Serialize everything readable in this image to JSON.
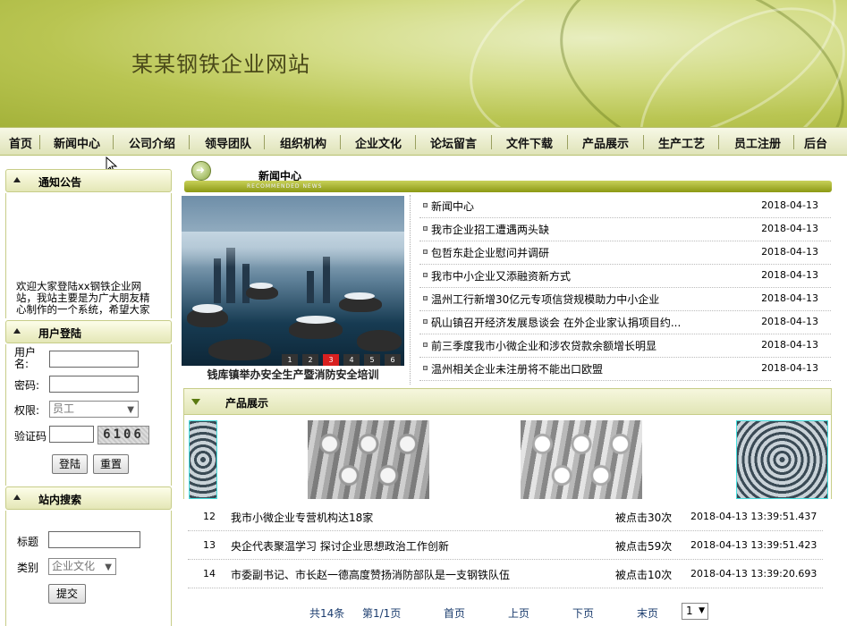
{
  "site": {
    "title": "某某钢铁企业网站"
  },
  "nav": [
    "首页",
    "新闻中心",
    "公司介绍",
    "领导团队",
    "组织机构",
    "企业文化",
    "论坛留言",
    "文件下载",
    "产品展示",
    "生产工艺",
    "员工注册",
    "后台"
  ],
  "notice": {
    "title": "通知公告",
    "text": "欢迎大家登陆xx钢铁企业网站，我站主要是为广大朋友精心制作的一个系统，希望大家"
  },
  "login": {
    "title": "用户登陆",
    "username_label": "用户名:",
    "password_label": "密码:",
    "role_label": "权限:",
    "role_value": "员工",
    "captcha_label": "验证码",
    "captcha_text": "6106",
    "login_button": "登陆",
    "reset_button": "重置"
  },
  "search": {
    "title": "站内搜索",
    "title_label": "标题",
    "category_label": "类别",
    "category_value": "企业文化",
    "submit_button": "提交"
  },
  "news": {
    "title": "新闻中心",
    "subtitle": "RECOMMENDED NEWS",
    "photo_caption": "钱库镇举办安全生产暨消防安全培训",
    "pager": [
      "1",
      "2",
      "3",
      "4",
      "5",
      "6"
    ],
    "pager_active": "3",
    "items": [
      {
        "title": "新闻中心",
        "date": "2018-04-13"
      },
      {
        "title": "我市企业招工遭遇两头缺",
        "date": "2018-04-13"
      },
      {
        "title": "包哲东赴企业慰问并调研",
        "date": "2018-04-13"
      },
      {
        "title": "我市中小企业又添融资新方式",
        "date": "2018-04-13"
      },
      {
        "title": "温州工行新增30亿元专项信贷规模助力中小企业",
        "date": "2018-04-13"
      },
      {
        "title": "矾山镇召开经济发展恳谈会 在外企业家认捐项目约...",
        "date": "2018-04-13"
      },
      {
        "title": "前三季度我市小微企业和涉农贷款余额增长明显",
        "date": "2018-04-13"
      },
      {
        "title": "温州相关企业未注册将不能出口欧盟",
        "date": "2018-04-13"
      }
    ]
  },
  "products": {
    "title": "产品展示"
  },
  "list": {
    "rows": [
      {
        "no": "12",
        "title": "我市小微企业专营机构达18家",
        "hits": "被点击30次",
        "date": "2018-04-13 13:39:51.437"
      },
      {
        "no": "13",
        "title": "央企代表聚温学习 探讨企业思想政治工作创新",
        "hits": "被点击59次",
        "date": "2018-04-13 13:39:51.423"
      },
      {
        "no": "14",
        "title": "市委副书记、市长赵一德高度赞扬消防部队是一支钢铁队伍",
        "hits": "被点击10次",
        "date": "2018-04-13 13:39:20.693"
      }
    ]
  },
  "pagination": {
    "total": "共14条",
    "page": "第1/1页",
    "first": "首页",
    "prev": "上页",
    "next": "下页",
    "last": "末页",
    "select_value": "1"
  }
}
